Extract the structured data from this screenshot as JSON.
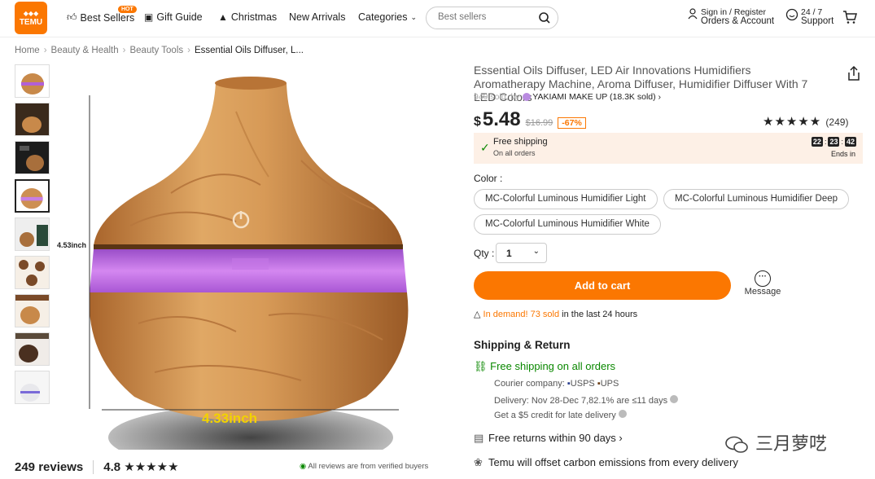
{
  "header": {
    "logo_text": "TEMU",
    "nav": {
      "best_sellers": "Best Sellers",
      "hot_badge": "HOT",
      "gift_guide": "Gift Guide",
      "christmas": "Christmas",
      "new_arrivals": "New Arrivals",
      "categories": "Categories"
    },
    "search": {
      "placeholder": "Best sellers"
    },
    "account": {
      "line1": "Sign in / Register",
      "line2": "Orders & Account"
    },
    "support": {
      "line1": "24 / 7",
      "line2": "Support"
    }
  },
  "breadcrumb": [
    "Home",
    "Beauty & Health",
    "Beauty Tools",
    "Essential Oils Diffuser, L..."
  ],
  "gallery": {
    "measure_height": "4.53inch",
    "measure_width": "4.33inch",
    "thumb_count": 9,
    "selected_index": 3
  },
  "reviews": {
    "count_label": "249 reviews",
    "rating": "4.8",
    "stars": "★★★★★",
    "verified_text": "All reviews are from verified buyers"
  },
  "product": {
    "title": "Essential Oils Diffuser, LED Air Innovations Humidifiers Aromatherapy Machine, Aroma Diffuser, Humidifier Diffuser With 7 LED Colors",
    "sold": "949 sold, by",
    "store": "YAKIAMI MAKE UP (18.3K sold)",
    "currency": "$",
    "price": "5.48",
    "old_price": "$16.99",
    "discount": "-67%",
    "stars": "★★★★★",
    "rating_count": "(249)"
  },
  "promo": {
    "free_shipping": "Free shipping",
    "on_all_orders": "On all orders",
    "timer": [
      "22",
      "23",
      "42"
    ],
    "ends_in": "Ends in"
  },
  "options": {
    "color_label": "Color :",
    "colors": [
      "MC-Colorful Luminous Humidifier Light",
      "MC-Colorful Luminous Humidifier Deep",
      "MC-Colorful Luminous Humidifier White"
    ]
  },
  "qty": {
    "label": "Qty :",
    "value": "1"
  },
  "add_to_cart": "Add to cart",
  "message": "Message",
  "demand": {
    "prefix": "In demand! 73 sold",
    "suffix": " in the last 24 hours"
  },
  "shipping": {
    "title": "Shipping & Return",
    "free_all": "Free shipping on all orders",
    "courier_label": "Courier company:",
    "usps": "USPS",
    "ups": "UPS",
    "delivery": "Delivery: Nov 28-Dec 7,82.1% are ≤11 days",
    "credit": "Get a $5 credit for late delivery",
    "returns": "Free returns within 90 days",
    "carbon": "Temu will offset carbon emissions from every delivery"
  },
  "watermark": "三月萝呓",
  "colors": {
    "accent": "#fb7701",
    "green": "#0a8800",
    "promo_bg": "#fdf0e6"
  }
}
